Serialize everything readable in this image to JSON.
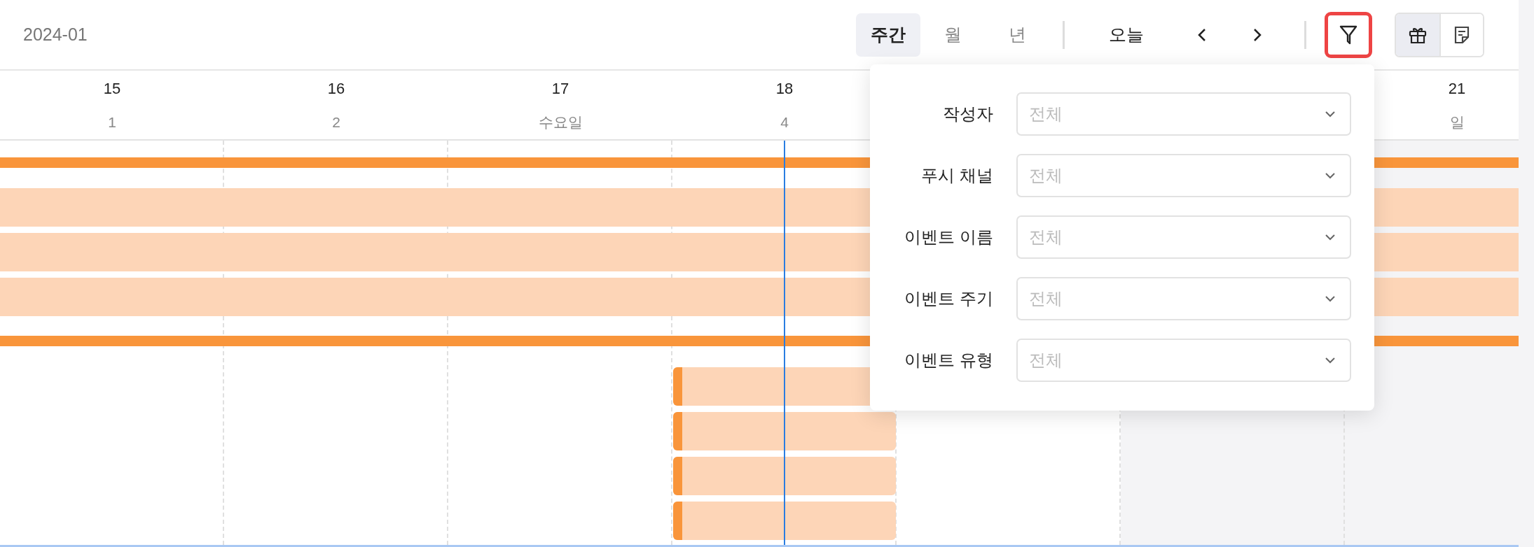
{
  "toolbar": {
    "period": "2024-01",
    "views": [
      {
        "label": "주간",
        "selected": true
      },
      {
        "label": "월",
        "selected": false
      },
      {
        "label": "년",
        "selected": false
      }
    ],
    "today_button": "오늘",
    "filter_highlighted": true,
    "display_toggle": [
      {
        "kind": "gift",
        "selected": true
      },
      {
        "kind": "note",
        "selected": false
      }
    ]
  },
  "days": [
    {
      "kind": "weekday",
      "date": "15",
      "label": "1",
      "today": false
    },
    {
      "kind": "weekday",
      "date": "16",
      "label": "2",
      "today": false
    },
    {
      "kind": "weekday",
      "date": "17",
      "label": "수요일",
      "today": false
    },
    {
      "kind": "weekday",
      "date": "18",
      "label": "4",
      "today": true,
      "events": [
        {
          "kind": "block"
        },
        {
          "kind": "block"
        },
        {
          "kind": "block"
        },
        {
          "kind": "block"
        }
      ]
    },
    {
      "kind": "weekday",
      "today": false
    },
    {
      "kind": "weekend",
      "today": false
    },
    {
      "kind": "weekend",
      "date": "21",
      "label": "일",
      "today": false
    }
  ],
  "lanes": [
    {
      "kind": "strip"
    },
    {
      "kind": "span"
    },
    {
      "kind": "span"
    },
    {
      "kind": "span"
    },
    {
      "kind": "strip"
    }
  ],
  "filter_panel": {
    "filters": [
      {
        "label": "작성자",
        "placeholder": "전체"
      },
      {
        "label": "푸시 채널",
        "placeholder": "전체"
      },
      {
        "label": "이벤트 이름",
        "placeholder": "전체"
      },
      {
        "label": "이벤트 주기",
        "placeholder": "전체"
      },
      {
        "label": "이벤트 유형",
        "placeholder": "전체"
      }
    ]
  }
}
